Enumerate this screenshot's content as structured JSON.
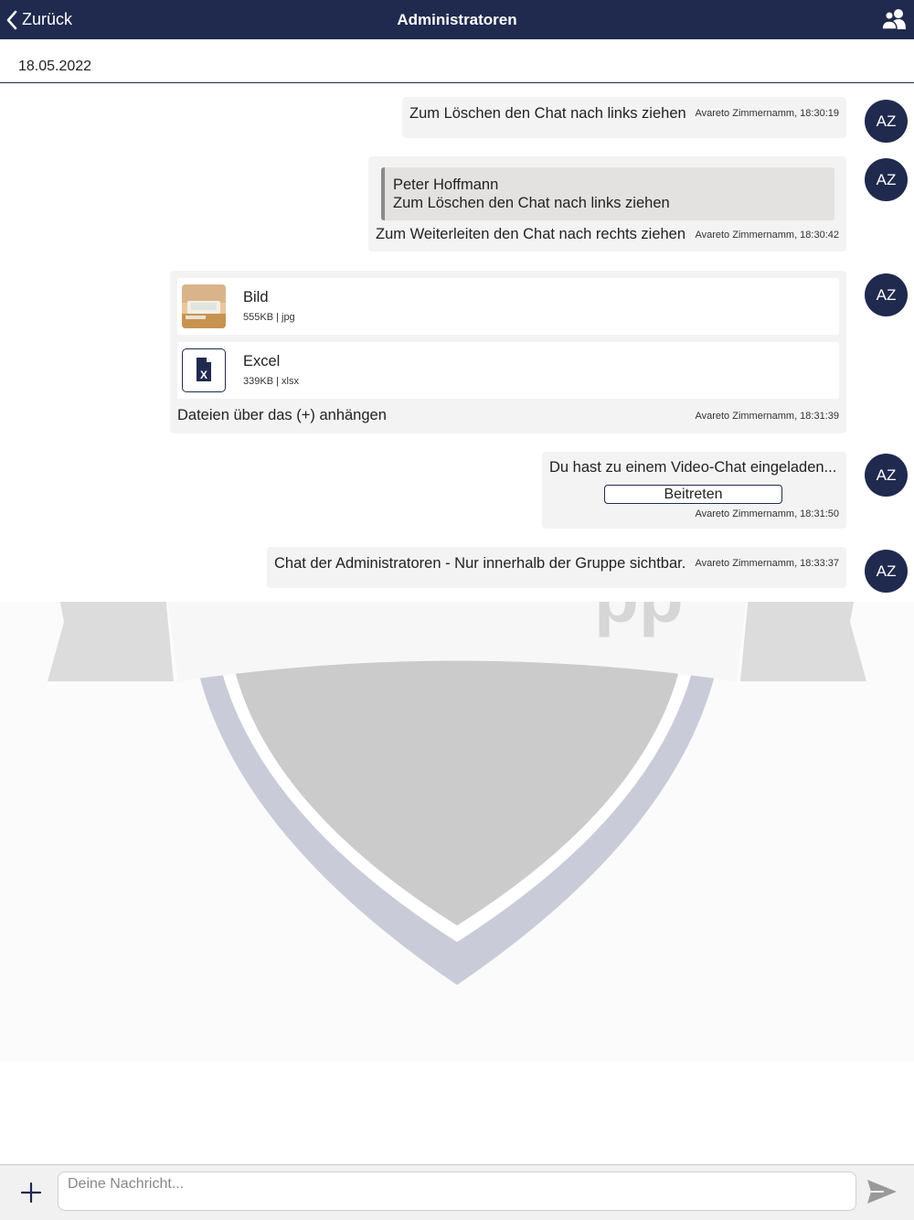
{
  "colors": {
    "navy": "#1f2a4e",
    "bubble": "#f3f3f3",
    "quote": "#e3e2e1",
    "send_icon": "#999999"
  },
  "header": {
    "back_label": "Zurück",
    "title": "Administratoren",
    "back_icon": "chevron-left-icon",
    "members_icon": "users-icon"
  },
  "date": "18.05.2022",
  "messages": [
    {
      "text": "Zum Löschen den Chat nach links ziehen",
      "meta": "Avareto Zimmernamm, 18:30:19",
      "avatar": "AZ"
    },
    {
      "quote_author": "Peter Hoffmann",
      "quote_text": "Zum Löschen den Chat nach links ziehen",
      "text": "Zum Weiterleiten den Chat nach rechts ziehen",
      "meta": "Avareto Zimmernamm, 18:30:42",
      "avatar": "AZ"
    },
    {
      "files": [
        {
          "name": "Bild",
          "info": "555KB | jpg",
          "icon": "image-thumbnail"
        },
        {
          "name": "Excel",
          "info": "339KB | xlsx",
          "icon": "excel-file-icon"
        }
      ],
      "text": "Dateien über das (+) anhängen",
      "meta": "Avareto Zimmernamm, 18:31:39",
      "avatar": "AZ"
    },
    {
      "text": "Du hast zu einem Video-Chat eingeladen...",
      "button": "Beitreten",
      "meta": "Avareto Zimmernamm, 18:31:50",
      "avatar": "AZ"
    },
    {
      "text": "Chat der Administratoren - Nur innerhalb der Gruppe sichtbar.",
      "meta": "Avareto Zimmernamm, 18:33:37",
      "avatar": "AZ"
    }
  ],
  "composer": {
    "placeholder": "Deine Nachricht...",
    "add_icon": "plus-icon",
    "send_icon": "send-icon"
  }
}
